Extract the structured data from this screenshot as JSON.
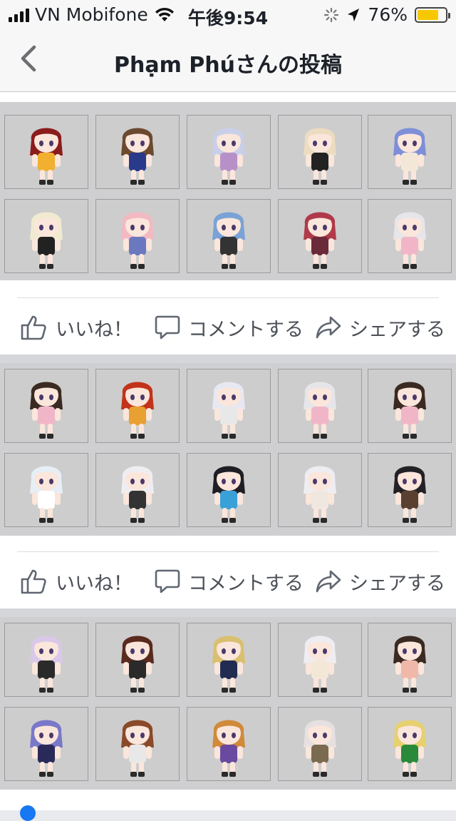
{
  "status_bar": {
    "carrier": "VN Mobifone",
    "time": "午後9:54",
    "battery_percent": "76%",
    "battery_level": 0.76
  },
  "nav": {
    "title": "Phạm Phúさんの投稿"
  },
  "actions": {
    "like": "いいね！",
    "comment": "コメントする",
    "share": "シェアする"
  },
  "colors": {
    "hair": [
      "#8b1c1c",
      "#6b4a30",
      "#c9cfe9",
      "#ecdcc0",
      "#7e8fd8",
      "#f0ead0",
      "#f2b9c2",
      "#7aa2d6",
      "#b03a4a",
      "#e6e6ea",
      "#3a2a22",
      "#c2331a",
      "#e8e8f2",
      "#e6e6ea",
      "#3a2a22",
      "#e6eef6",
      "#eeeef2",
      "#1e1e24",
      "#eeeef2",
      "#222226",
      "#d9c8e8",
      "#5a2a1e",
      "#d9c070",
      "#eeeef2",
      "#3a2a22",
      "#7a78c8",
      "#8a4a2a",
      "#d08a3a",
      "#e6e0e0",
      "#e6d070"
    ],
    "outfit": [
      "#f2b030",
      "#2a3a8a",
      "#b890c8",
      "#222222",
      "#f3e8d8",
      "#222222",
      "#6b78c0",
      "#333333",
      "#6a2a3a",
      "#f0b6c8",
      "#f0b6c8",
      "#e8a030",
      "#e8e8e8",
      "#f0b6c8",
      "#f0b6c8",
      "#ffffff",
      "#333333",
      "#3aa0d8",
      "#f0e8e0",
      "#5a4030",
      "#2a2a2a",
      "#2a2a2a",
      "#222c50",
      "#f3e8d8",
      "#f0b8a8",
      "#2a2a5a",
      "#e8e8e8",
      "#6a4aa0",
      "#7a6a50",
      "#2a8a3a"
    ]
  }
}
